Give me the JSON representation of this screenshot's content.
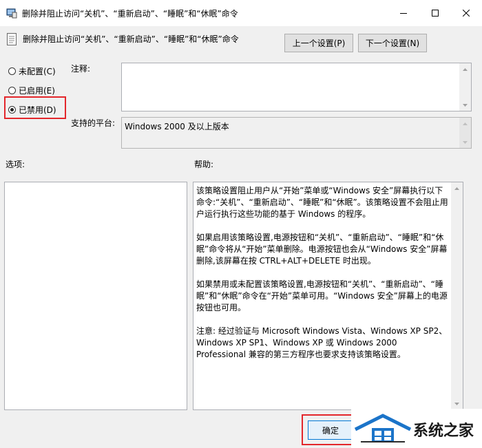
{
  "window": {
    "title": "删除并阻止访问“关机”、“重新启动”、“睡眠”和“休眠”命令"
  },
  "policy": {
    "name": "删除并阻止访问“关机”、“重新启动”、“睡眠”和“休眠”命令",
    "prev_label": "上一个设置(P)",
    "next_label": "下一个设置(N)"
  },
  "radios": {
    "not_configured": "未配置(C)",
    "enabled": "已启用(E)",
    "disabled": "已禁用(D)",
    "selected": "disabled"
  },
  "comment": {
    "label": "注释:",
    "value": ""
  },
  "platform": {
    "label": "支持的平台:",
    "value": "Windows 2000 及以上版本"
  },
  "options": {
    "label": "选项:"
  },
  "help": {
    "label": "帮助:",
    "paragraphs": [
      "该策略设置阻止用户从“开始”菜单或“Windows 安全”屏幕执行以下命令:“关机”、“重新启动”、“睡眠”和“休眠”。该策略设置不会阻止用户运行执行这些功能的基于 Windows 的程序。",
      "如果启用该策略设置,电源按钮和“关机”、“重新启动”、“睡眠”和“休眠”命令将从“开始”菜单删除。电源按钮也会从“Windows 安全”屏幕删除,该屏幕在按 CTRL+ALT+DELETE 时出现。",
      "如果禁用或未配置该策略设置,电源按钮和“关机”、“重新启动”、“睡眠”和“休眠”命令在“开始”菜单可用。“Windows 安全”屏幕上的电源按钮也可用。",
      "注意: 经过验证与 Microsoft Windows Vista、Windows XP SP2、Windows XP SP1、Windows XP 或 Windows 2000 Professional 兼容的第三方程序也要求支持该策略设置。"
    ]
  },
  "footer": {
    "ok_label": "确定"
  },
  "watermark": {
    "text": "系统之家"
  },
  "colors": {
    "highlight": "#e3262b",
    "ok_border": "#0078d7"
  }
}
